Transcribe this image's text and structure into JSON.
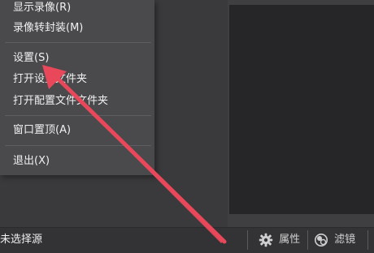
{
  "menu": {
    "items": [
      {
        "label": "显示录像(R)"
      },
      {
        "label": "录像转封装(M)"
      },
      {
        "label": "设置(S)"
      },
      {
        "label": "打开设置文件夹"
      },
      {
        "label": "打开配置文件文件夹"
      },
      {
        "label": "窗口置顶(A)"
      },
      {
        "label": "退出(X)"
      }
    ]
  },
  "status": {
    "source_label": "未选择源"
  },
  "tabs": [
    {
      "label": "属性",
      "icon": "gear-icon"
    },
    {
      "label": "滤镜",
      "icon": "filter-icon"
    }
  ],
  "annotation": {
    "arrow_color": "#e8485a"
  }
}
